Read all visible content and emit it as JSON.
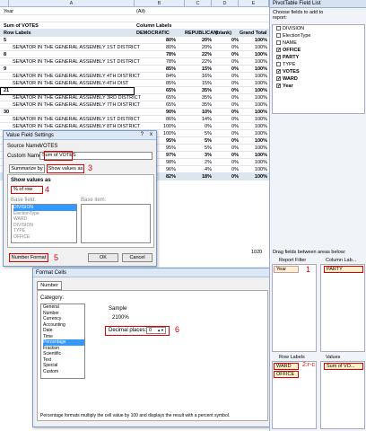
{
  "sheet": {
    "top_row_label": "Year",
    "top_row_value": "(All)",
    "columns": [
      "A",
      "B",
      "C",
      "D",
      "E"
    ],
    "values_caption": "Sum of VOTES",
    "col_labels": "Column Labels",
    "row_labels": "Row Labels",
    "democratic": "DEMOCRATIC",
    "republican": "REPUBLICAN",
    "blank": "(blank)",
    "grand_total": "Grand Total",
    "rows": [
      {
        "label": "5",
        "d": "80%",
        "r": "20%",
        "b": "0%",
        "g": "100%",
        "group": true
      },
      {
        "label": "SENATOR IN THE GENERAL ASSEMBLY 1ST DISTRICT",
        "d": "80%",
        "r": "20%",
        "b": "0%",
        "g": "100%"
      },
      {
        "label": "8",
        "d": "78%",
        "r": "22%",
        "b": "0%",
        "g": "100%",
        "group": true
      },
      {
        "label": "SENATOR IN THE GENERAL ASSEMBLY 1ST DISTRICT",
        "d": "78%",
        "r": "22%",
        "b": "0%",
        "g": "100%"
      },
      {
        "label": "9",
        "d": "85%",
        "r": "15%",
        "b": "0%",
        "g": "100%",
        "group": true
      },
      {
        "label": "SENATOR IN THE GENERAL ASSEMBLY 4TH DISTRICT",
        "d": "84%",
        "r": "16%",
        "b": "0%",
        "g": "100%"
      },
      {
        "label": "SENATOR IN THE GENERAL ASSEMBLY-4TH DIST",
        "d": "85%",
        "r": "15%",
        "b": "0%",
        "g": "100%"
      },
      {
        "label": "21",
        "d": "65%",
        "r": "35%",
        "b": "0%",
        "g": "100%",
        "group": true
      },
      {
        "label": "SENATOR IN THE GENERAL ASSEMBLY 3RD DISTRICT",
        "d": "65%",
        "r": "35%",
        "b": "0%",
        "g": "100%"
      },
      {
        "label": "SENATOR IN THE GENERAL ASSEMBLY 7TH DISTRICT",
        "d": "65%",
        "r": "35%",
        "b": "0%",
        "g": "100%"
      },
      {
        "label": "30",
        "d": "90%",
        "r": "10%",
        "b": "0%",
        "g": "100%",
        "group": true
      },
      {
        "label": "SENATOR IN THE GENERAL ASSEMBLY 1ST DISTRICT",
        "d": "86%",
        "r": "14%",
        "b": "0%",
        "g": "100%"
      },
      {
        "label": "SENATOR IN THE GENERAL ASSEMBLY 8TH DISTRICT",
        "d": "100%",
        "r": "0%",
        "b": "0%",
        "g": "100%"
      },
      {
        "label": "",
        "d": "100%",
        "r": "5%",
        "b": "0%",
        "g": "100%"
      },
      {
        "label": "",
        "d": "95%",
        "r": "5%",
        "b": "0%",
        "g": "100%",
        "bold": true
      },
      {
        "label": "",
        "d": "95%",
        "r": "5%",
        "b": "0%",
        "g": "100%"
      },
      {
        "label": "",
        "d": "97%",
        "r": "3%",
        "b": "0%",
        "g": "100%",
        "bold": true
      },
      {
        "label": "",
        "d": "98%",
        "r": "2%",
        "b": "0%",
        "g": "100%"
      },
      {
        "label": "",
        "d": "96%",
        "r": "4%",
        "b": "0%",
        "g": "100%"
      },
      {
        "label": "",
        "d": "82%",
        "r": "18%",
        "b": "0%",
        "g": "100%",
        "bold": true,
        "total": true
      }
    ],
    "stray_value": "1020"
  },
  "vfs": {
    "title": "Value Field Settings",
    "source_label": "Source Name:",
    "source_value": "VOTES",
    "custom_label": "Custom Name:",
    "custom_value": "Sum of VOTES",
    "tab1": "Summarize by",
    "tab2": "Show values as",
    "show_values_as": "Show values as",
    "dropdown": "% of row",
    "base_field": "Base field:",
    "base_item": "Base item:",
    "base_fields": [
      "DIVISION",
      "ElectionType",
      "WARD",
      "DIVISION",
      "TYPE",
      "OFFICE"
    ],
    "number_format": "Number Format",
    "ok": "OK",
    "cancel": "Cancel",
    "help": "?",
    "close": "x"
  },
  "fc": {
    "title": "Format Cells",
    "tab": "Number",
    "category_label": "Category:",
    "categories": [
      "General",
      "Number",
      "Currency",
      "Accounting",
      "Date",
      "Time",
      "Percentage",
      "Fraction",
      "Scientific",
      "Text",
      "Special",
      "Custom"
    ],
    "selected": "Percentage",
    "sample_label": "Sample",
    "sample_value": "2100%",
    "decimal_label": "Decimal places:",
    "decimal_value": "0",
    "description": "Percentage formats multiply the cell value by 100 and displays the result with a percent symbol.",
    "ok": "OK",
    "cancel": "Cancel"
  },
  "fieldlist": {
    "title": "PivotTable Field List",
    "choose": "Choose fields to add to report:",
    "fields": [
      {
        "name": "DIVISION",
        "checked": false
      },
      {
        "name": "ElectionType",
        "checked": false
      },
      {
        "name": "NAME",
        "checked": false
      },
      {
        "name": "OFFICE",
        "checked": true
      },
      {
        "name": "PARTY",
        "checked": true
      },
      {
        "name": "TYPE",
        "checked": false
      },
      {
        "name": "VOTES",
        "checked": true
      },
      {
        "name": "WARD",
        "checked": true
      },
      {
        "name": "Year",
        "checked": true
      }
    ],
    "drag_label": "Drag fields between areas below:",
    "report_filter": "Report Filter",
    "column_labels": "Column Lab...",
    "row_labels": "Row Labels",
    "values": "Values",
    "filter_item": "Year",
    "column_item": "PARTY",
    "row_items": [
      "WARD",
      "OFFICE"
    ],
    "value_item": "Sum of VO...",
    "annot1": "1",
    "annot2": "2:r-c"
  },
  "annotations": {
    "n3": "3",
    "n4": "4",
    "n5": "5",
    "n6": "6"
  }
}
